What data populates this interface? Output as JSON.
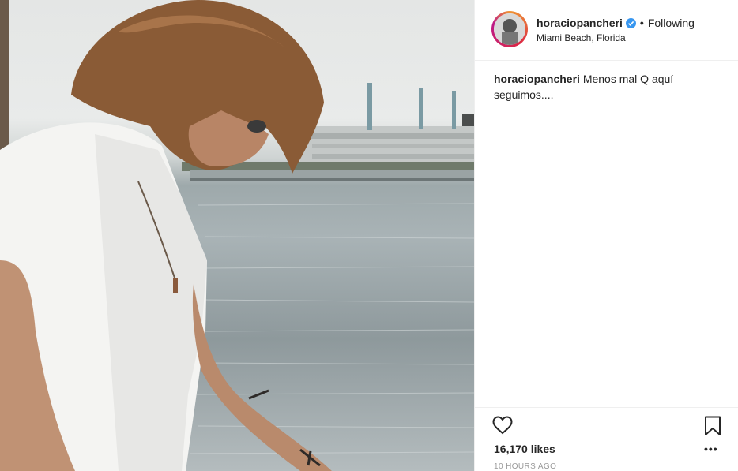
{
  "post": {
    "username": "horaciopancheri",
    "following_label": "Following",
    "separator": "•",
    "location": "Miami Beach, Florida",
    "caption_user": "horaciopancheri",
    "caption_text": "Menos mal Q aquí seguimos....",
    "likes": "16,170 likes",
    "timestamp": "10 HOURS AGO"
  },
  "icons": {
    "verified": "verified-badge-icon",
    "like": "heart-icon",
    "save": "bookmark-icon",
    "more": "more-options-icon"
  },
  "colors": {
    "verified": "#3897f0",
    "text": "#262626",
    "muted": "#999999",
    "border": "#efefef"
  }
}
